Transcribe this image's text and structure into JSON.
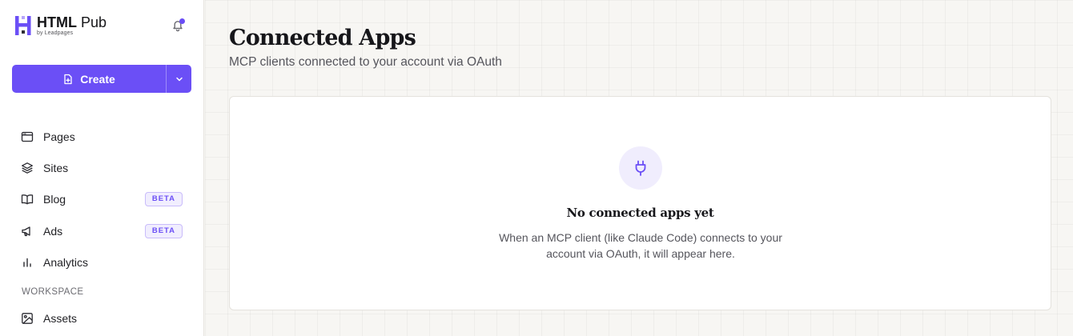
{
  "brand": {
    "title_bold": "HTML",
    "title_rest": " Pub",
    "subtitle": "by Leadpages"
  },
  "actions": {
    "create_label": "Create"
  },
  "nav": {
    "items": [
      {
        "label": "Pages",
        "icon": "browser-window-icon",
        "badge": ""
      },
      {
        "label": "Sites",
        "icon": "layers-icon",
        "badge": ""
      },
      {
        "label": "Blog",
        "icon": "open-book-icon",
        "badge": "BETA"
      },
      {
        "label": "Ads",
        "icon": "megaphone-icon",
        "badge": "BETA"
      },
      {
        "label": "Analytics",
        "icon": "bar-chart-icon",
        "badge": ""
      }
    ],
    "section_label": "WORKSPACE",
    "workspace_items": [
      {
        "label": "Assets",
        "icon": "image-icon"
      }
    ]
  },
  "main": {
    "title": "Connected Apps",
    "subtitle": "MCP clients connected to your account via OAuth",
    "empty_state": {
      "icon": "plug-icon",
      "title": "No connected apps yet",
      "description": "When an MCP client (like Claude Code) connects to your account via OAuth, it will appear here."
    }
  },
  "colors": {
    "accent": "#6b4ff6",
    "accent_soft": "#f0edfd",
    "background": "#f7f6f3"
  }
}
